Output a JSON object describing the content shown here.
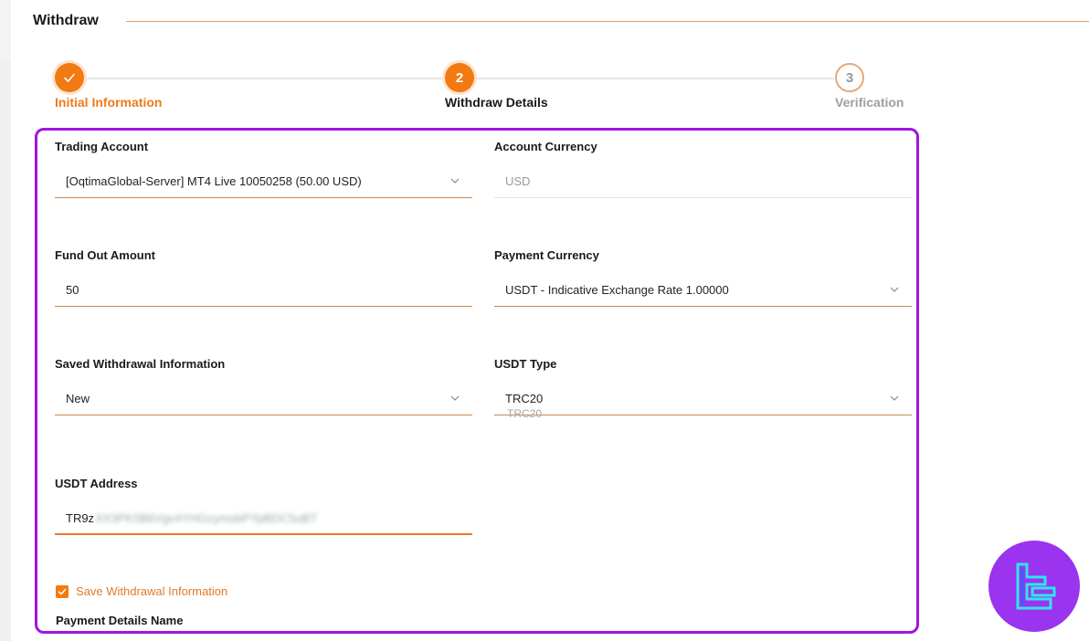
{
  "header": {
    "title": "Withdraw"
  },
  "stepper": {
    "steps": [
      {
        "number": "1",
        "label": "Initial Information",
        "state": "done"
      },
      {
        "number": "2",
        "label": "Withdraw Details",
        "state": "active"
      },
      {
        "number": "3",
        "label": "Verification",
        "state": "pending"
      }
    ]
  },
  "form": {
    "trading_account": {
      "label": "Trading Account",
      "value": "[OqtimaGlobal-Server] MT4 Live 10050258 (50.00 USD)"
    },
    "account_currency": {
      "label": "Account Currency",
      "value": "USD"
    },
    "fund_out_amount": {
      "label": "Fund Out Amount",
      "value": "50"
    },
    "payment_currency": {
      "label": "Payment Currency",
      "value": "USDT - Indicative Exchange Rate 1.00000"
    },
    "saved_withdrawal_info": {
      "label": "Saved Withdrawal Information",
      "value": "New"
    },
    "usdt_type": {
      "label": "USDT Type",
      "value": "TRC20",
      "hint": "TRC20"
    },
    "usdt_address": {
      "label": "USDT Address",
      "value_visible": "TR9z",
      "value_obscured": "XX3PK5B6Vgv4YHGzymobPYpBDC5uBT"
    },
    "save_info": {
      "label": "Save Withdrawal Information",
      "checked": true
    },
    "payment_details_name": {
      "label": "Payment Details Name"
    }
  },
  "colors": {
    "accent": "#f27a12",
    "frame": "#a214e0",
    "logo_bg": "#9a34ef",
    "logo_fg": "#2ee6f0"
  },
  "icons": {
    "step_done": "check-icon",
    "dropdown": "chevron-down-icon",
    "checkbox": "check-icon",
    "logo": "tc-logo-icon"
  }
}
